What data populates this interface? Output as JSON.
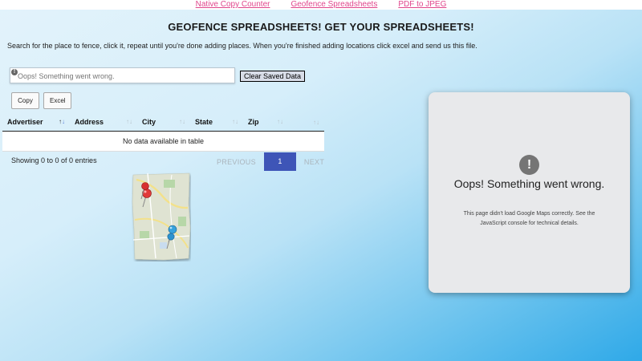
{
  "nav": {
    "links": [
      "Native Copy Counter",
      "Geofence Spreadsheets",
      "PDF to JPEG"
    ]
  },
  "header": {
    "title": "GEOFENCE SPREADSHEETS! GET YOUR SPREADSHEETS!",
    "instructions": "Search for the place to fence, click it, repeat until you're done adding places. When you're finished adding locations click excel and send us this file."
  },
  "search": {
    "placeholder": "Oops! Something went wrong.",
    "warning_icon": "!"
  },
  "buttons": {
    "clear_saved_data": "Clear Saved Data",
    "copy": "Copy",
    "excel": "Excel"
  },
  "table": {
    "columns": [
      "Advertiser",
      "Address",
      "City",
      "State",
      "Zip",
      ""
    ],
    "empty_message": "No data available in table",
    "info": "Showing 0 to 0 of 0 entries",
    "sort_glyph_up": "↑",
    "sort_glyph_down": "↓"
  },
  "pagination": {
    "previous": "PREVIOUS",
    "page": "1",
    "next": "NEXT"
  },
  "map_error": {
    "icon": "!",
    "title": "Oops! Something went wrong.",
    "message": "This page didn't load Google Maps correctly. See the JavaScript console for technical details."
  },
  "colors": {
    "link": "#e0468c",
    "pagination_active": "#3e55b7",
    "background_end": "#2fa9e8"
  }
}
